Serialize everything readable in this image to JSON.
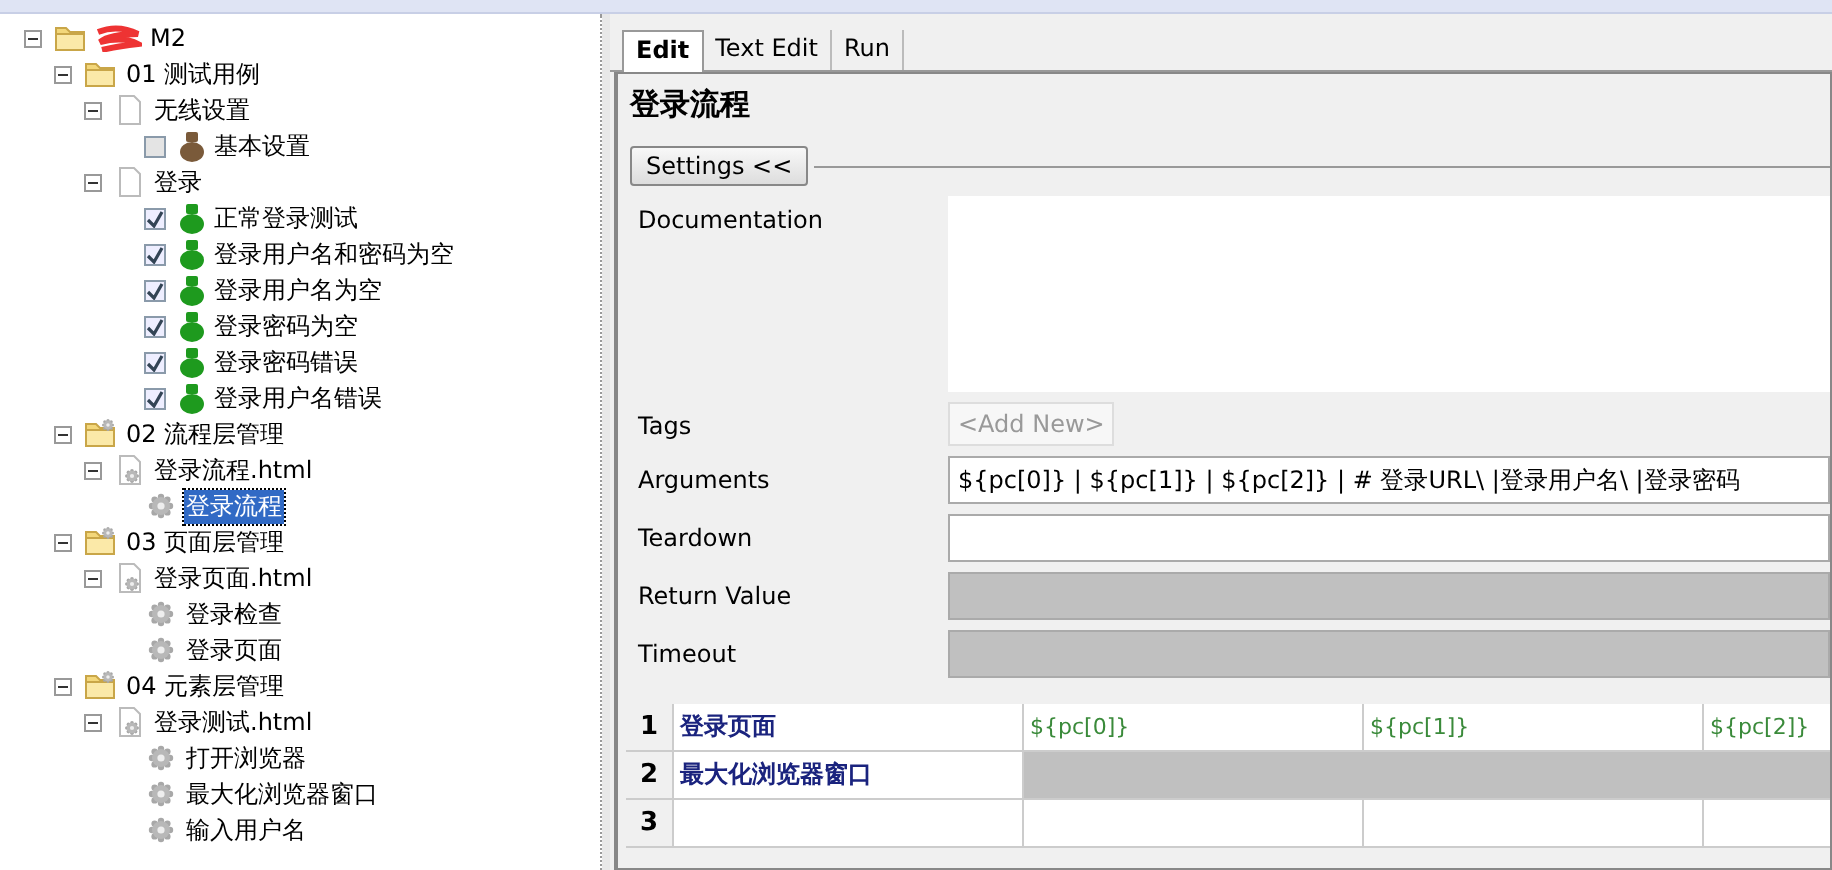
{
  "tree": [
    {
      "label": "M2",
      "kind": "folder",
      "redacted": true,
      "expanded": true,
      "children": [
        {
          "label": "01 测试用例",
          "kind": "folder",
          "expanded": true,
          "children": [
            {
              "label": "无线设置",
              "kind": "file",
              "expanded": true,
              "children": [
                {
                  "label": "基本设置",
                  "kind": "test",
                  "checked": false,
                  "color": "#7a5a3a"
                }
              ]
            },
            {
              "label": "登录",
              "kind": "file",
              "expanded": true,
              "children": [
                {
                  "label": "正常登录测试",
                  "kind": "test",
                  "checked": true,
                  "color": "#1e9a1e"
                },
                {
                  "label": "登录用户名和密码为空",
                  "kind": "test",
                  "checked": true,
                  "color": "#1e9a1e"
                },
                {
                  "label": "登录用户名为空",
                  "kind": "test",
                  "checked": true,
                  "color": "#1e9a1e"
                },
                {
                  "label": "登录密码为空",
                  "kind": "test",
                  "checked": true,
                  "color": "#1e9a1e"
                },
                {
                  "label": "登录密码错误",
                  "kind": "test",
                  "checked": true,
                  "color": "#1e9a1e"
                },
                {
                  "label": "登录用户名错误",
                  "kind": "test",
                  "checked": true,
                  "color": "#1e9a1e"
                }
              ]
            }
          ]
        },
        {
          "label": "02 流程层管理",
          "kind": "suite",
          "expanded": true,
          "children": [
            {
              "label": "登录流程.html",
              "kind": "resource",
              "expanded": true,
              "children": [
                {
                  "label": "登录流程",
                  "kind": "keyword",
                  "selected": true
                }
              ]
            }
          ]
        },
        {
          "label": "03 页面层管理",
          "kind": "suite",
          "expanded": true,
          "children": [
            {
              "label": "登录页面.html",
              "kind": "resource",
              "expanded": true,
              "children": [
                {
                  "label": "登录检查",
                  "kind": "keyword",
                  "selected": false
                },
                {
                  "label": "登录页面",
                  "kind": "keyword",
                  "selected": false
                }
              ]
            }
          ]
        },
        {
          "label": "04 元素层管理",
          "kind": "suite",
          "expanded": true,
          "children": [
            {
              "label": "登录测试.html",
              "kind": "resource",
              "expanded": true,
              "children": [
                {
                  "label": "打开浏览器",
                  "kind": "keyword",
                  "selected": false
                },
                {
                  "label": "最大化浏览器窗口",
                  "kind": "keyword",
                  "selected": false
                },
                {
                  "label": "输入用户名",
                  "kind": "keyword",
                  "selected": false
                }
              ]
            }
          ]
        }
      ]
    }
  ],
  "tabs": [
    {
      "label": "Edit",
      "selected": true
    },
    {
      "label": "Text Edit",
      "selected": false
    },
    {
      "label": "Run",
      "selected": false
    }
  ],
  "editor": {
    "title": "登录流程",
    "settings_button": "Settings <<",
    "fields": [
      {
        "label": "Documentation",
        "kind": "textarea"
      },
      {
        "label": "Tags",
        "kind": "tags",
        "placeholder": "<Add New>"
      },
      {
        "label": "Arguments",
        "kind": "text",
        "value": "${pc[0]} | ${pc[1]} | ${pc[2]} | # 登录URL\\ |登录用户名\\ |登录密码"
      },
      {
        "label": "Teardown",
        "kind": "text"
      },
      {
        "label": "Return Value",
        "kind": "text",
        "disabled": true
      },
      {
        "label": "Timeout",
        "kind": "text",
        "disabled": true
      }
    ]
  },
  "grid": {
    "rows": [
      {
        "number": "1",
        "cells": [
          {
            "text": "登录页面",
            "kind": "keyword",
            "disabled": false
          },
          {
            "text": "${pc[0]}",
            "kind": "argument",
            "disabled": false
          },
          {
            "text": "${pc[1]}",
            "kind": "argument",
            "disabled": false
          },
          {
            "text": "${pc[2]}",
            "kind": "argument",
            "disabled": false
          }
        ]
      },
      {
        "number": "2",
        "cells": [
          {
            "text": "最大化浏览器窗口",
            "kind": "keyword",
            "disabled": false
          },
          {
            "kind": "argument",
            "disabled": true
          },
          {
            "kind": "argument",
            "disabled": true
          },
          {
            "kind": "argument",
            "disabled": true
          }
        ]
      },
      {
        "number": "3",
        "cells": [
          {
            "kind": "keyword",
            "disabled": false
          },
          {
            "kind": "argument",
            "disabled": false
          },
          {
            "kind": "argument",
            "disabled": false
          },
          {
            "kind": "argument",
            "disabled": false
          }
        ]
      }
    ]
  }
}
